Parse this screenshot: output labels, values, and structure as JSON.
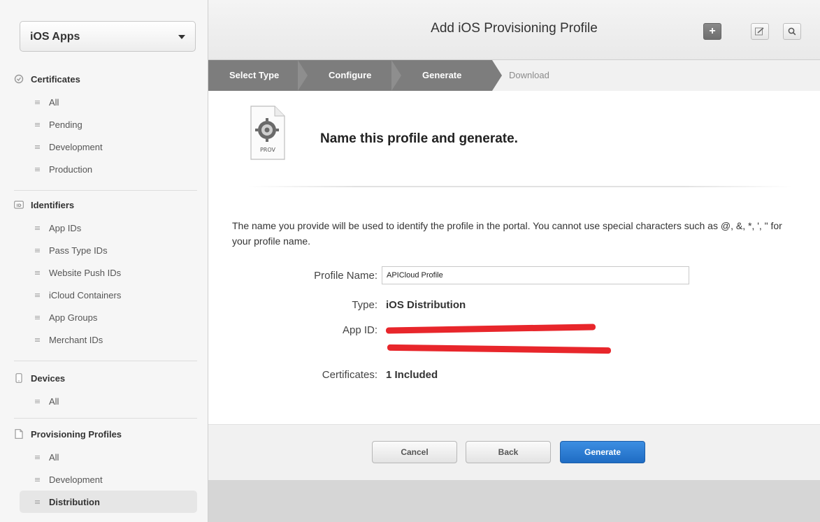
{
  "sidebar": {
    "app_select": "iOS Apps",
    "sections": [
      {
        "title": "Certificates",
        "icon": "certificate-icon",
        "items": [
          "All",
          "Pending",
          "Development",
          "Production"
        ]
      },
      {
        "title": "Identifiers",
        "icon": "id-icon",
        "items": [
          "App IDs",
          "Pass Type IDs",
          "Website Push IDs",
          "iCloud Containers",
          "App Groups",
          "Merchant IDs"
        ]
      },
      {
        "title": "Devices",
        "icon": "device-icon",
        "items": [
          "All"
        ]
      },
      {
        "title": "Provisioning Profiles",
        "icon": "document-icon",
        "items": [
          "All",
          "Development",
          "Distribution"
        ]
      }
    ],
    "selected": "Distribution"
  },
  "header": {
    "title": "Add iOS Provisioning Profile",
    "add_symbol": "+",
    "search_symbol": "🔍"
  },
  "steps": {
    "select_type": "Select Type",
    "configure": "Configure",
    "generate": "Generate",
    "download": "Download"
  },
  "content": {
    "icon_label": "PROV",
    "heading": "Name this profile and generate.",
    "description": "The name you provide will be used to identify the profile in the portal. You cannot use special characters such as @, &, *, ', \" for your profile name.",
    "profile_name_label": "Profile Name:",
    "profile_name_value": "APICloud Profile",
    "type_label": "Type:",
    "type_value": "iOS Distribution",
    "app_id_label": "App ID:",
    "certificates_label": "Certificates:",
    "certificates_value": "1 Included"
  },
  "footer": {
    "cancel": "Cancel",
    "back": "Back",
    "generate": "Generate"
  },
  "colors": {
    "primary_button": "#1f6cc4",
    "active_step": "#7d7d7d",
    "redaction": "#e8262b"
  }
}
